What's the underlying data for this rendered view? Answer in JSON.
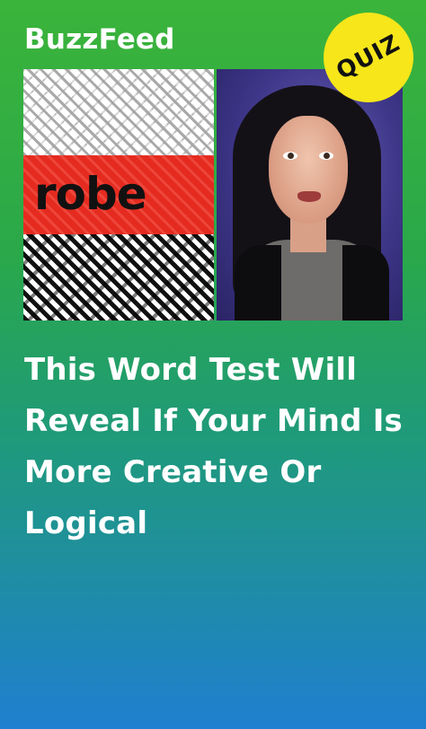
{
  "brand": {
    "name": "BuzzFeed"
  },
  "badge": {
    "label": "QUIZ",
    "color": "#f6e61a"
  },
  "hero": {
    "word": "robe",
    "accent_color": "#e52b20"
  },
  "headline": "This Word Test Will Reveal If Your Mind Is More Creative Or Logical"
}
